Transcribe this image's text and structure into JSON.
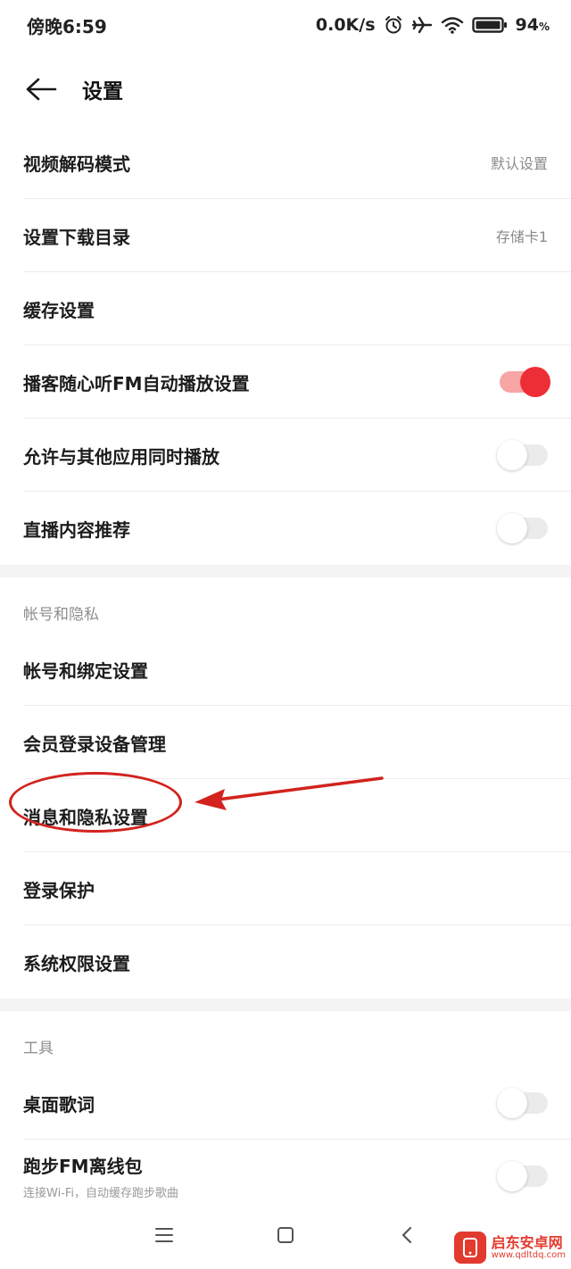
{
  "status_bar": {
    "time": "傍晚6:59",
    "network_speed": "0.0K/s",
    "battery_level": "94",
    "battery_unit": "%",
    "icons": [
      "alarm-icon",
      "airplane-icon",
      "wifi-icon",
      "battery-icon"
    ]
  },
  "header": {
    "title": "设置"
  },
  "general": {
    "video_decode": {
      "label": "视频解码模式",
      "value": "默认设置"
    },
    "download_dir": {
      "label": "设置下载目录",
      "value": "存储卡1"
    },
    "cache": {
      "label": "缓存设置"
    },
    "fm_autoplay": {
      "label": "播客随心听FM自动播放设置",
      "enabled": true
    },
    "allow_other_apps": {
      "label": "允许与其他应用同时播放",
      "enabled": false
    },
    "live_recommend": {
      "label": "直播内容推荐",
      "enabled": false
    }
  },
  "account": {
    "section_title": "帐号和隐私",
    "binding": {
      "label": "帐号和绑定设置"
    },
    "member_devices": {
      "label": "会员登录设备管理"
    },
    "message_privacy": {
      "label": "消息和隐私设置"
    },
    "login_protect": {
      "label": "登录保护"
    },
    "system_permission": {
      "label": "系统权限设置"
    }
  },
  "tools": {
    "section_title": "工具",
    "desktop_lyrics": {
      "label": "桌面歌词",
      "enabled": false
    },
    "running_fm": {
      "label": "跑步FM离线包",
      "sublabel": "连接Wi-Fi，自动缓存跑步歌曲",
      "enabled": false
    }
  },
  "watermark": {
    "name": "启东安卓网",
    "url": "www.qdltdq.com"
  },
  "colors": {
    "accent": "#ee2e36",
    "annotation": "#d2231e"
  }
}
